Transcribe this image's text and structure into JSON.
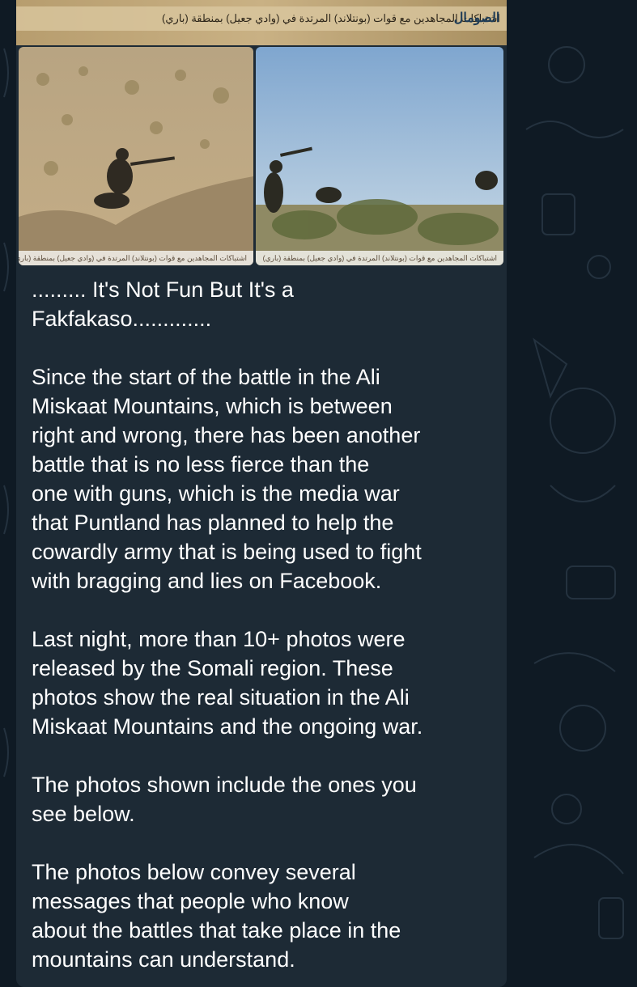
{
  "chat": {
    "background_color": "#0f1a24",
    "bubble_color": "#1d2a35",
    "text_color": "#ffffff"
  },
  "media": {
    "top_photo_caption": "اشتباكات المجاهدين مع قوات (بونتلاند) المرتدة في (وادي جعيل) بمنطقة (باري)",
    "top_photo_logo": "الصومال",
    "left_photo_caption": "اشتباكات المجاهدين مع قوات (بونتلاند) المرتدة في (وادي جعيل) بمنطقة (باري)",
    "right_photo_caption": "اشتباكات المجاهدين مع قوات (بونتلاند) المرتدة في (وادي جعيل) بمنطقة (باري)"
  },
  "message": {
    "heading": "......... It's Not Fun But It's a\nFakfakaso.............",
    "paragraph_1": "Since the start of the battle in the Ali\nMiskaat Mountains, which is between\nright and wrong, there has been another\nbattle that is no less fierce than the\none with guns, which is the media war\nthat Puntland has planned to help the\ncowardly army that is being used to fight\nwith bragging and lies on Facebook.",
    "paragraph_2": "Last night, more than 10+ photos were\nreleased by the Somali region. These\nphotos show the real situation in the Ali\nMiskaat Mountains and the ongoing war.",
    "paragraph_3": "The photos shown include the ones you\nsee below.",
    "paragraph_4": "The photos below convey several\nmessages that people who know\nabout the battles that take place in the\nmountains can understand."
  }
}
